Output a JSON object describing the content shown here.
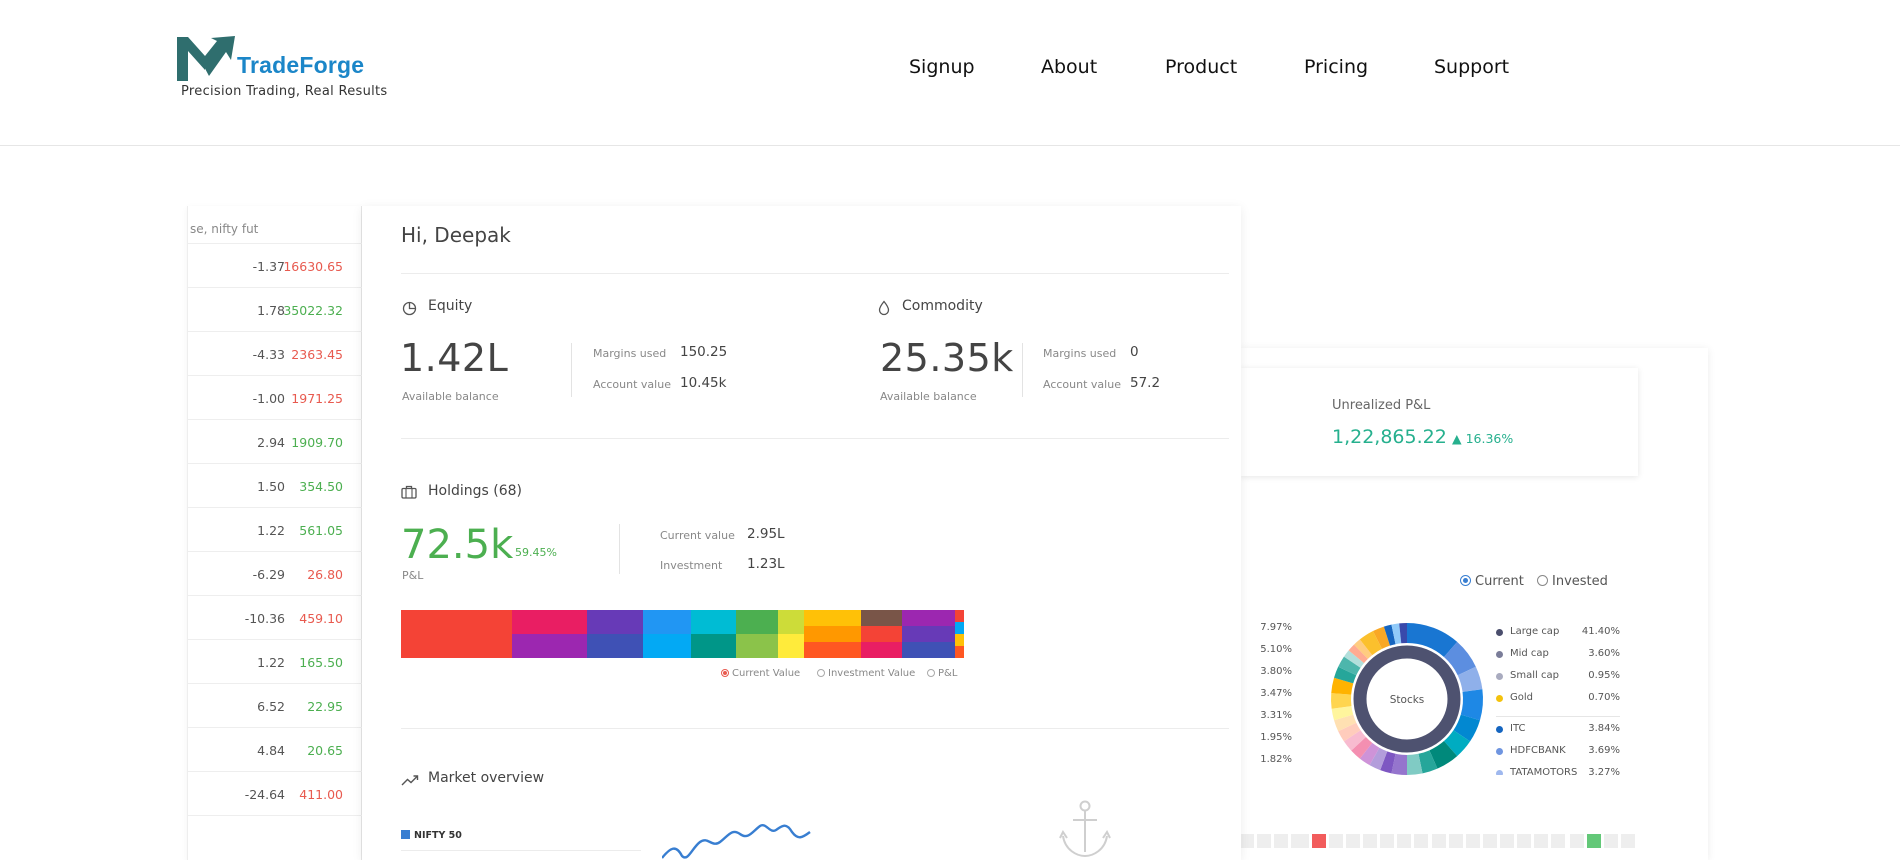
{
  "header": {
    "brand_name": "TradeForge",
    "tagline": "Precision Trading, Real Results",
    "nav": [
      {
        "label": "Signup"
      },
      {
        "label": "About"
      },
      {
        "label": "Product"
      },
      {
        "label": "Pricing"
      },
      {
        "label": "Support"
      }
    ]
  },
  "watchlist": {
    "search_fragment": "se, nifty fut",
    "rows": [
      {
        "change": "-1.37",
        "price": "16630.65",
        "trend": "down"
      },
      {
        "change": "1.78",
        "price": "35022.32",
        "trend": "up"
      },
      {
        "change": "-4.33",
        "price": "2363.45",
        "trend": "down"
      },
      {
        "change": "-1.00",
        "price": "1971.25",
        "trend": "down"
      },
      {
        "change": "2.94",
        "price": "1909.70",
        "trend": "up"
      },
      {
        "change": "1.50",
        "price": "354.50",
        "trend": "up"
      },
      {
        "change": "1.22",
        "price": "561.05",
        "trend": "up"
      },
      {
        "change": "-6.29",
        "price": "26.80",
        "trend": "down"
      },
      {
        "change": "-10.36",
        "price": "459.10",
        "trend": "down"
      },
      {
        "change": "1.22",
        "price": "165.50",
        "trend": "up"
      },
      {
        "change": "6.52",
        "price": "22.95",
        "trend": "up"
      },
      {
        "change": "4.84",
        "price": "20.65",
        "trend": "up"
      },
      {
        "change": "-24.64",
        "price": "411.00",
        "trend": "down"
      }
    ]
  },
  "dashboard": {
    "greeting": "Hi, Deepak",
    "equity": {
      "title": "Equity",
      "value": "1.42L",
      "value_label": "Available balance",
      "margins_label": "Margins used",
      "margins_value": "150.25",
      "account_label": "Account value",
      "account_value": "10.45k"
    },
    "commodity": {
      "title": "Commodity",
      "value": "25.35k",
      "value_label": "Available balance",
      "margins_label": "Margins used",
      "margins_value": "0",
      "account_label": "Account value",
      "account_value": "57.2"
    },
    "holdings": {
      "title": "Holdings (68)",
      "pnl_value": "72.5k",
      "pnl_pct": "59.45%",
      "pnl_label": "P&L",
      "current_label": "Current value",
      "current_value": "2.95L",
      "investment_label": "Investment",
      "investment_value": "1.23L",
      "legend": [
        "Current Value",
        "Investment Value",
        "P&L"
      ]
    },
    "market": {
      "title": "Market overview",
      "series_label": "NIFTY 50"
    }
  },
  "right_panel": {
    "unrealized_label": "Unrealized P&L",
    "unrealized_value": "1,22,865.22",
    "unrealized_pct": "▲ 16.36%",
    "toggle": [
      "Current",
      "Invested"
    ],
    "left_percents": [
      "7.97%",
      "5.10%",
      "3.80%",
      "3.47%",
      "3.31%",
      "1.95%",
      "1.82%"
    ],
    "donut_center": "Stocks",
    "legend_caps": [
      {
        "name": "Large cap",
        "value": "41.40%",
        "color": "#4b4e6d"
      },
      {
        "name": "Mid cap",
        "value": "3.60%",
        "color": "#7a7d99"
      },
      {
        "name": "Small cap",
        "value": "0.95%",
        "color": "#a9abbf"
      },
      {
        "name": "Gold",
        "value": "0.70%",
        "color": "#f4c20d"
      }
    ],
    "legend_stocks": [
      {
        "name": "ITC",
        "value": "3.84%",
        "color": "#1565c0"
      },
      {
        "name": "HDFCBANK",
        "value": "3.69%",
        "color": "#6f95e0"
      },
      {
        "name": "TATAMOTORS",
        "value": "3.27%",
        "color": "#9fb8ee"
      }
    ]
  },
  "colors": {
    "brand": "#1b86c8",
    "logo_mark": "#2f6e6e",
    "positive": "#4caf50",
    "negative": "#e85a4f",
    "teal_positive": "#26b08e",
    "accent": "#387ed1"
  }
}
